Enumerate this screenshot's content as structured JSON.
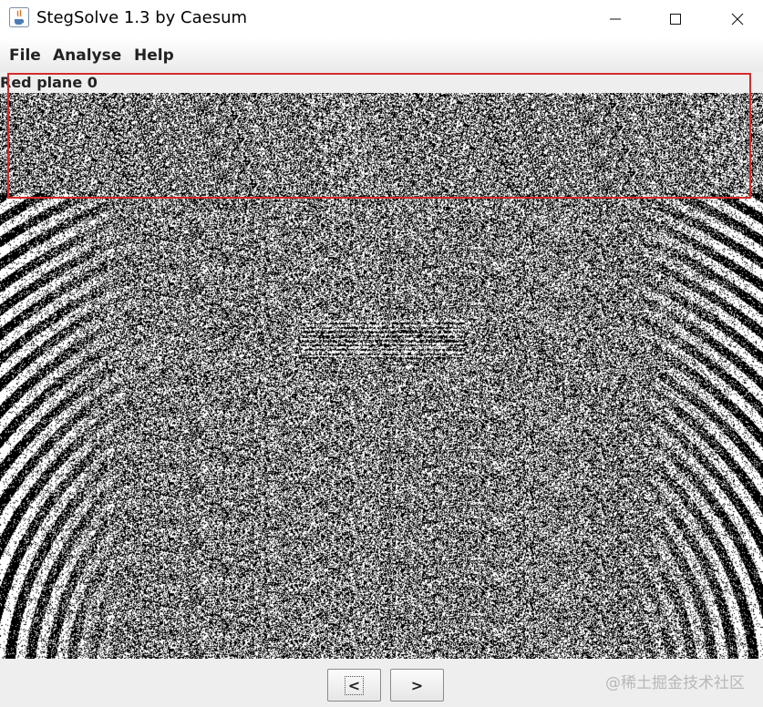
{
  "window": {
    "title": "StegSolve 1.3 by Caesum",
    "app_icon": "java-cup-icon",
    "controls": {
      "minimize_icon": "minimize-icon",
      "maximize_icon": "maximize-icon",
      "close_icon": "close-icon"
    }
  },
  "menu": {
    "items": [
      {
        "label": "File"
      },
      {
        "label": "Analyse"
      },
      {
        "label": "Help"
      }
    ]
  },
  "viewer": {
    "plane_label": "Red plane 0",
    "highlight_color": "#d42a2a"
  },
  "navigation": {
    "prev_label": "<",
    "next_label": ">"
  },
  "watermark": {
    "text": "@稀土掘金技术社区"
  }
}
